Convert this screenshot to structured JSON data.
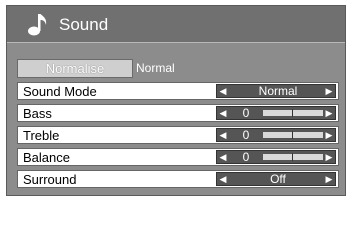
{
  "header": {
    "title": "Sound",
    "icon": "music-note-icon"
  },
  "normalise": {
    "button_label": "Normalise",
    "value": "Normal"
  },
  "rows": [
    {
      "label": "Sound Mode",
      "value": "Normal",
      "type": "select"
    },
    {
      "label": "Bass",
      "value": "0",
      "type": "slider",
      "level": 0.5
    },
    {
      "label": "Treble",
      "value": "0",
      "type": "slider",
      "level": 0.5
    },
    {
      "label": "Balance",
      "value": "0",
      "type": "slider",
      "level": 0.5
    },
    {
      "label": "Surround",
      "value": "Off",
      "type": "select"
    }
  ],
  "colors": {
    "panel": "#8c8c8c",
    "control": "#555555",
    "row": "#ffffff"
  }
}
